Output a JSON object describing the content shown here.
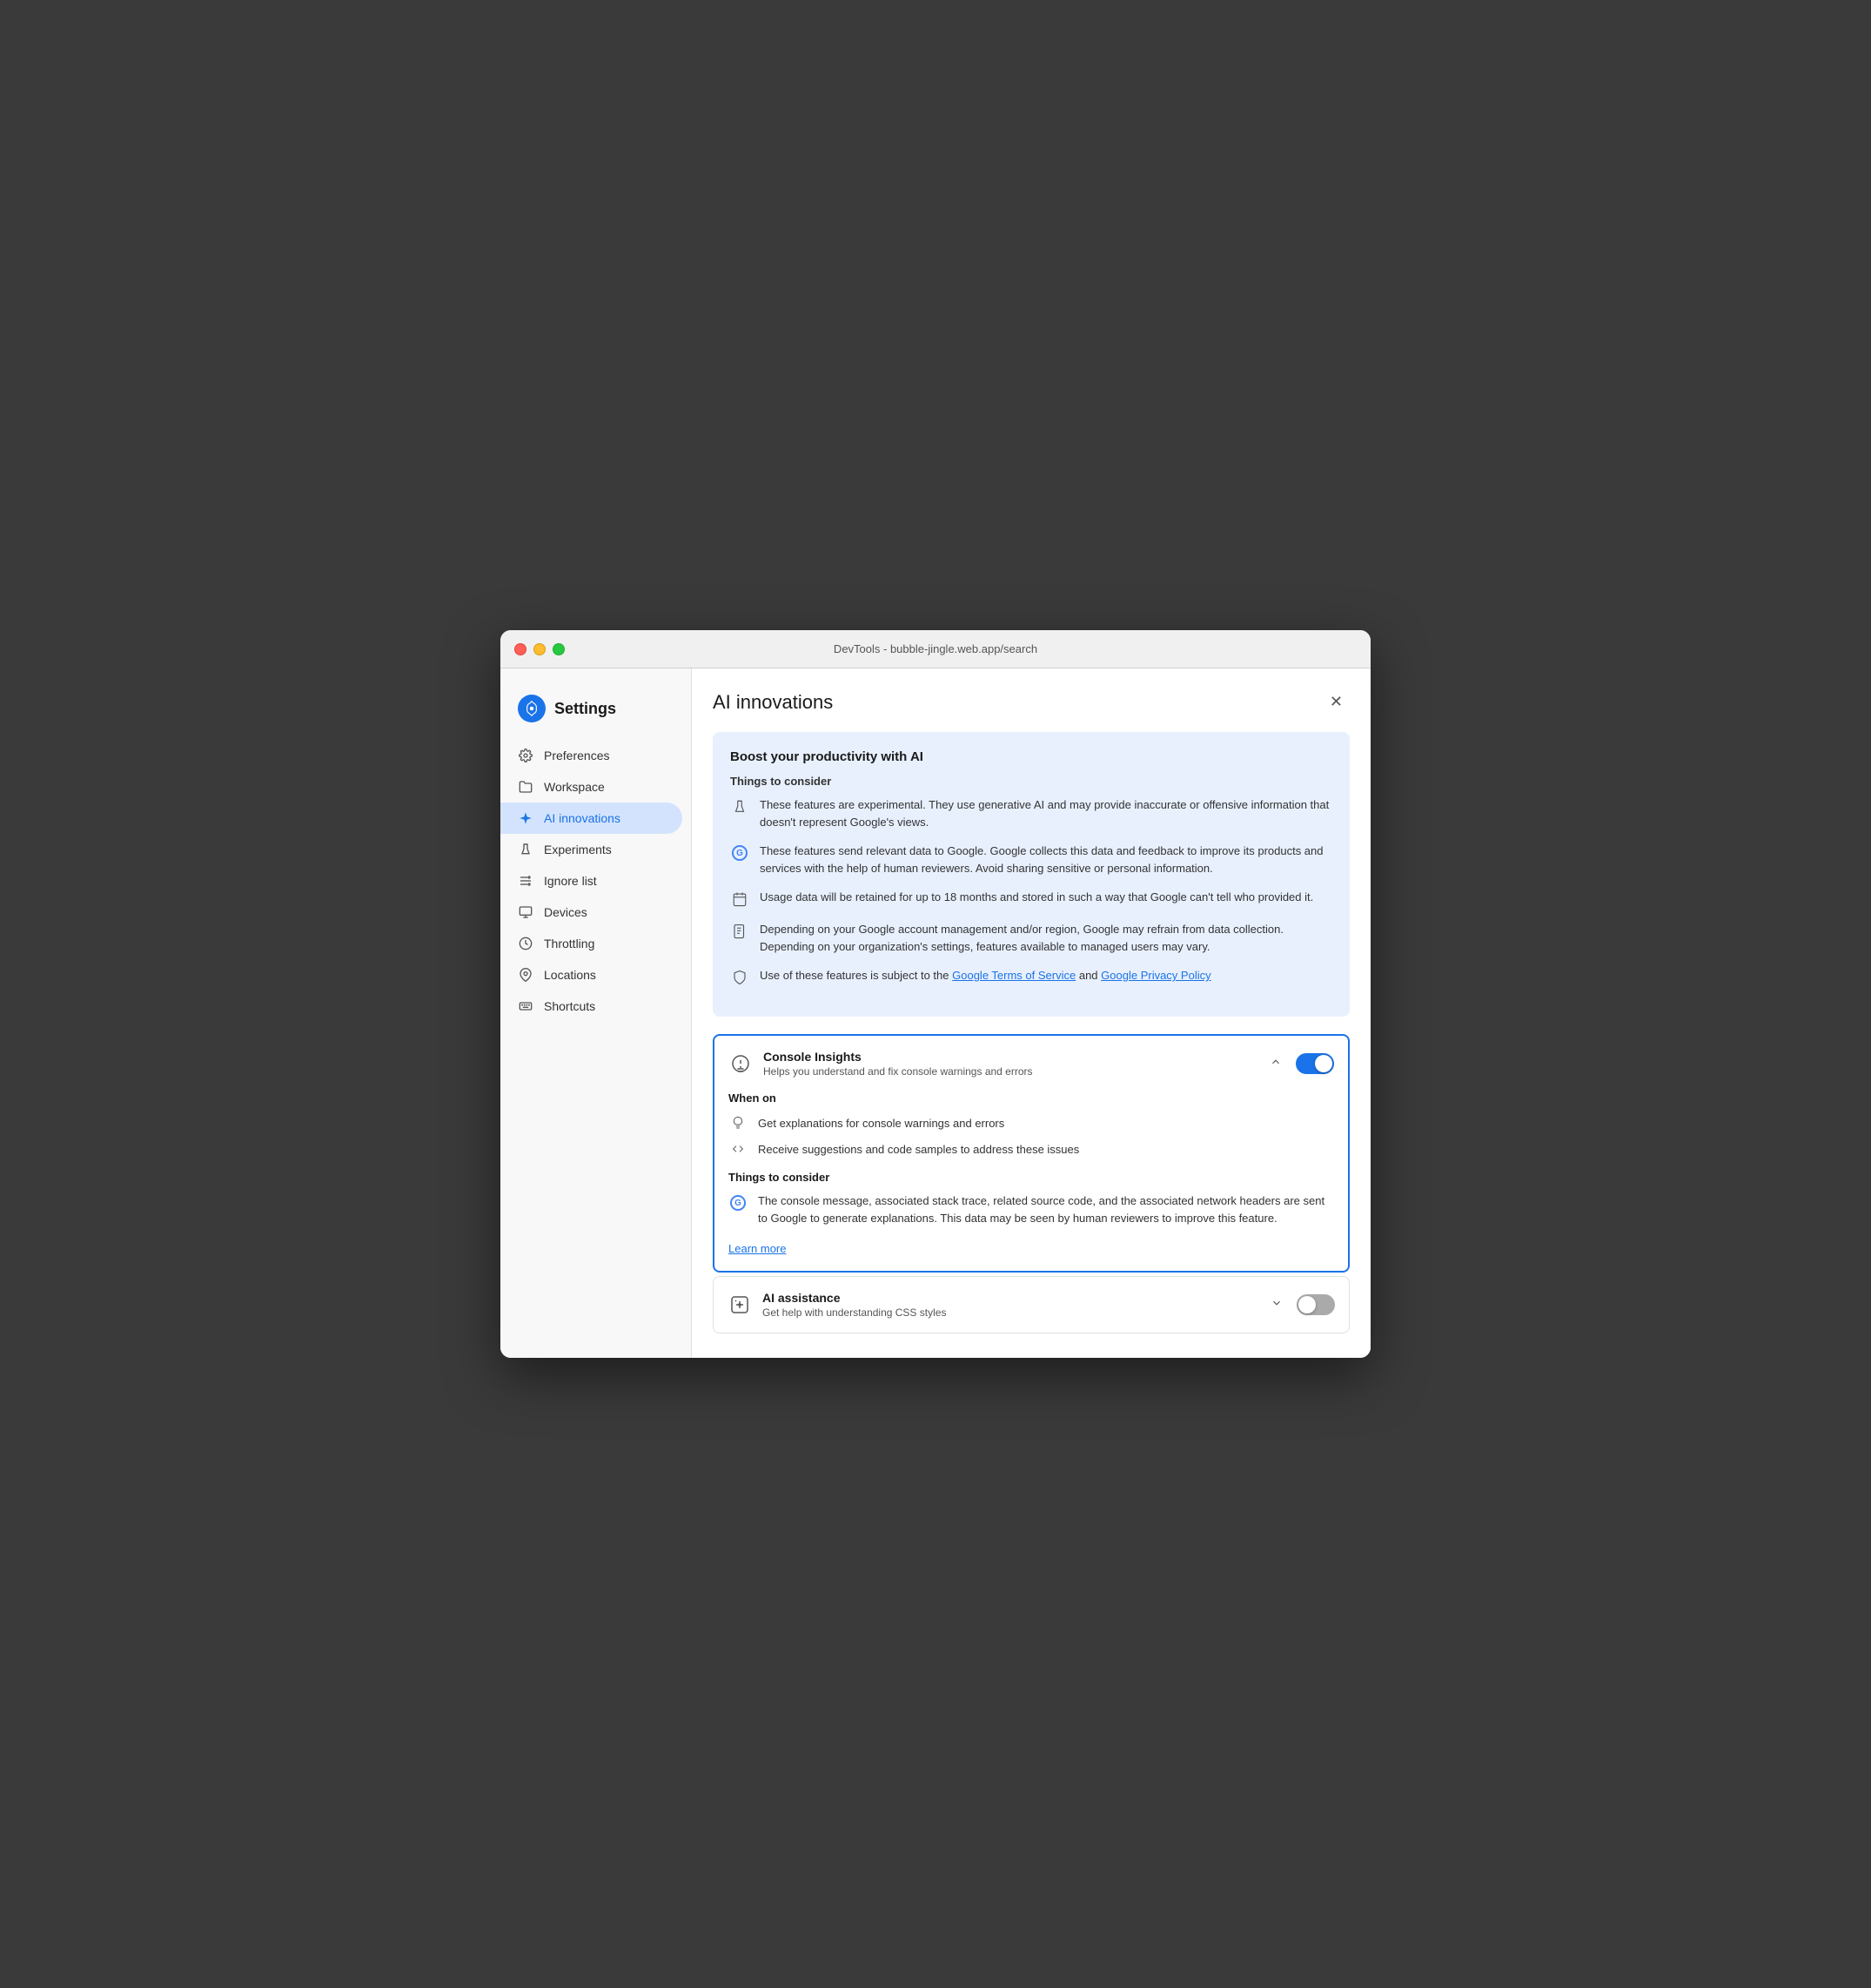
{
  "window": {
    "title": "DevTools - bubble-jingle.web.app/search",
    "close_label": "✕"
  },
  "sidebar": {
    "header_title": "Settings",
    "items": [
      {
        "id": "preferences",
        "label": "Preferences",
        "icon": "gear"
      },
      {
        "id": "workspace",
        "label": "Workspace",
        "icon": "folder"
      },
      {
        "id": "ai-innovations",
        "label": "AI innovations",
        "icon": "ai",
        "active": true
      },
      {
        "id": "experiments",
        "label": "Experiments",
        "icon": "flask"
      },
      {
        "id": "ignore-list",
        "label": "Ignore list",
        "icon": "list"
      },
      {
        "id": "devices",
        "label": "Devices",
        "icon": "device"
      },
      {
        "id": "throttling",
        "label": "Throttling",
        "icon": "throttle"
      },
      {
        "id": "locations",
        "label": "Locations",
        "icon": "location"
      },
      {
        "id": "shortcuts",
        "label": "Shortcuts",
        "icon": "keyboard"
      }
    ]
  },
  "main": {
    "title": "AI innovations",
    "info_box": {
      "title": "Boost your productivity with AI",
      "subtitle": "Things to consider",
      "items": [
        {
          "icon": "ai",
          "text": "These features are experimental. They use generative AI and may provide inaccurate or offensive information that doesn't represent Google's views."
        },
        {
          "icon": "google",
          "text": "These features send relevant data to Google. Google collects this data and feedback to improve its products and services with the help of human reviewers. Avoid sharing sensitive or personal information."
        },
        {
          "icon": "calendar",
          "text": "Usage data will be retained for up to 18 months and stored in such a way that Google can't tell who provided it."
        },
        {
          "icon": "document",
          "text": "Depending on your Google account management and/or region, Google may refrain from data collection. Depending on your organization's settings, features available to managed users may vary."
        },
        {
          "icon": "shield",
          "text": "Use of these features is subject to the "
        }
      ],
      "tos_link": "Google Terms of Service",
      "tos_middle": " and ",
      "privacy_link": "Google Privacy Policy"
    },
    "console_insights": {
      "name": "Console Insights",
      "description": "Helps you understand and fix console warnings and errors",
      "enabled": true,
      "expanded": true,
      "when_on_title": "When on",
      "when_on_items": [
        {
          "icon": "lightbulb",
          "text": "Get explanations for console warnings and errors"
        },
        {
          "icon": "code",
          "text": "Receive suggestions and code samples to address these issues"
        }
      ],
      "things_title": "Things to consider",
      "things_items": [
        {
          "icon": "google",
          "text": "The console message, associated stack trace, related source code, and the associated network headers are sent to Google to generate explanations. This data may be seen by human reviewers to improve this feature."
        }
      ],
      "learn_more_label": "Learn more"
    },
    "ai_assistance": {
      "name": "AI assistance",
      "description": "Get help with understanding CSS styles",
      "enabled": false,
      "expanded": false
    }
  }
}
